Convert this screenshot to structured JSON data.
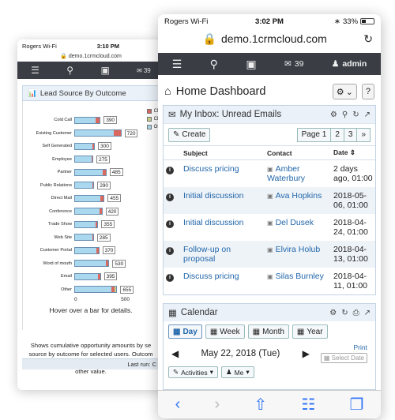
{
  "back_phone": {
    "status": {
      "carrier": "Rogers Wi-Fi",
      "time": "3:10 PM"
    },
    "url": "demo.1crmcloud.com",
    "nav": {
      "mail_count": "39"
    },
    "panel_title": "Lead Source By Outcome",
    "legend": [
      {
        "label": "Cl",
        "color": "#d9685e"
      },
      {
        "label": "Cl",
        "color": "#c8d48a"
      },
      {
        "label": "Ot",
        "color": "#aad8ee"
      }
    ],
    "chart_data": {
      "type": "bar",
      "orientation": "horizontal",
      "stacked": true,
      "title": "Lead Source By Outcome",
      "categories": [
        "Cold Call",
        "Existing Customer",
        "Self Generated",
        "Employee",
        "Partner",
        "Public Relations",
        "Direct Mail",
        "Conference",
        "Trade Show",
        "Web Site",
        "Customer Portal",
        "Word of mouth",
        "Email",
        "Other"
      ],
      "totals": [
        390,
        720,
        300,
        275,
        485,
        290,
        455,
        420,
        355,
        285,
        370,
        530,
        395,
        655
      ],
      "series": [
        {
          "name": "Ot",
          "values": [
            330,
            610,
            280,
            265,
            440,
            270,
            400,
            390,
            330,
            270,
            340,
            490,
            365,
            575
          ]
        },
        {
          "name": "Cl",
          "values": [
            60,
            110,
            20,
            10,
            45,
            20,
            55,
            30,
            25,
            15,
            30,
            40,
            30,
            50
          ]
        },
        {
          "name": "Cl",
          "values": [
            0,
            0,
            0,
            0,
            0,
            0,
            0,
            0,
            0,
            0,
            0,
            0,
            0,
            30
          ]
        }
      ],
      "xlim": [
        0,
        750
      ],
      "xticks": [
        "0",
        "500"
      ]
    },
    "hover_hint": "Hover over a bar for details.",
    "description": "Shows cumulative opportunity amounts by se source by outcome for selected users. Outcom whether the sales stage is Closed Won, Close other value.",
    "last_run": "Last run: C"
  },
  "front_phone": {
    "status": {
      "carrier": "Rogers Wi-Fi",
      "time": "3:02 PM",
      "battery": "33%"
    },
    "url": "demo.1crmcloud.com",
    "nav": {
      "mail_count": "39",
      "user": "admin"
    },
    "dashboard_title": "Home Dashboard",
    "inbox": {
      "title": "My Inbox: Unread Emails",
      "create_label": "Create",
      "pages": [
        "Page 1",
        "2",
        "3"
      ],
      "columns": {
        "subject": "Subject",
        "contact": "Contact",
        "date": "Date"
      },
      "rows": [
        {
          "subject": "Discuss pricing",
          "contact": "Amber Waterbury",
          "date": "2 days ago, 01:00"
        },
        {
          "subject": "Initial discussion",
          "contact": "Ava Hopkins",
          "date": "2018-05-06, 01:00"
        },
        {
          "subject": "Initial discussion",
          "contact": "Del Dusek",
          "date": "2018-04-24, 01:00"
        },
        {
          "subject": "Follow-up on proposal",
          "contact": "Elvira Holub",
          "date": "2018-04-13, 01:00"
        },
        {
          "subject": "Discuss pricing",
          "contact": "Silas Burnley",
          "date": "2018-04-11, 01:00"
        }
      ]
    },
    "calendar": {
      "title": "Calendar",
      "tabs": [
        "Day",
        "Week",
        "Month",
        "Year"
      ],
      "current_date": "May 22, 2018 (Tue)",
      "print_label": "Print",
      "select_date_placeholder": "Select Date",
      "activities_label": "Activities",
      "user_filter": "Me"
    }
  }
}
